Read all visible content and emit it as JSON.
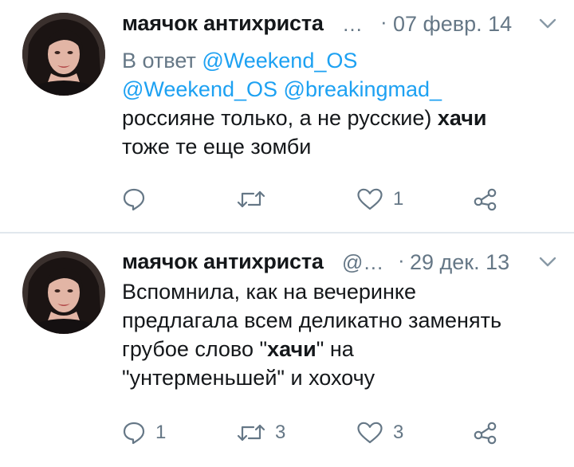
{
  "tweets": [
    {
      "author_name": "маячок антихриста",
      "handle_truncated": "…",
      "separator": "·",
      "date": "07 февр. 14",
      "reply_prefix": "В ответ",
      "reply_to_1": "@Weekend_OS",
      "mention_1": "@Weekend_OS",
      "mention_2": "@breakingmad_",
      "text_line_1_a": "россияне только, а не русские) ",
      "text_line_1_b": "хачи",
      "text_line_2": "тоже те еще зомби",
      "reply_count": "",
      "retweet_count": "",
      "like_count": "1"
    },
    {
      "author_name": "маячок антихриста",
      "handle_truncated": "@…",
      "separator": "·",
      "date": "29 дек. 13",
      "text_line_1": "Вспомнила, как на вечеринке",
      "text_line_2": "предлагала всем деликатно заменять",
      "text_line_3_a": "грубое слово \"",
      "text_line_3_b": "хачи",
      "text_line_3_c": "\" на",
      "text_line_4": "\"унтерменьшей\" и хохочу",
      "reply_count": "1",
      "retweet_count": "3",
      "like_count": "3"
    }
  ],
  "icons": {
    "reply": "speech-bubble-icon",
    "retweet": "retweet-arrows-icon",
    "like": "heart-outline-icon",
    "share": "share-nodes-icon",
    "menu": "chevron-down-icon"
  },
  "colors": {
    "text": "#14171a",
    "muted": "#657786",
    "link": "#1da1f2",
    "divider": "#e1e8ed"
  }
}
